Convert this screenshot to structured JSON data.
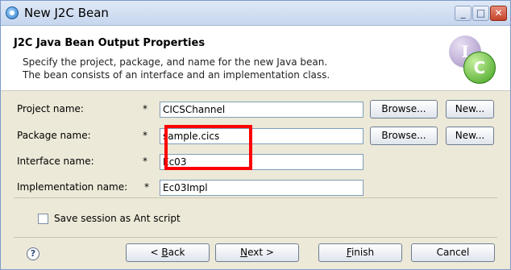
{
  "window": {
    "title": "New J2C Bean"
  },
  "header": {
    "title": "J2C Java Bean Output Properties",
    "desc_line1": "Specify the project, package, and name for the new Java bean.",
    "desc_line2": "The bean consists of an interface and an implementation class.",
    "badge_letter_1": "I",
    "badge_letter_2": "C"
  },
  "form": {
    "project": {
      "label": "Project name:",
      "required": "*",
      "value": "CICSChannel",
      "browse": "Browse...",
      "new": "New..."
    },
    "package": {
      "label": "Package name:",
      "required": "*",
      "value": "sample.cics",
      "browse": "Browse...",
      "new": "New..."
    },
    "interface": {
      "label": "Interface name:",
      "required": "*",
      "value": "Ec03"
    },
    "implementation": {
      "label": "Implementation name:",
      "required": "*",
      "value": "Ec03Impl"
    }
  },
  "options": {
    "save_session_label": "Save session as Ant script",
    "save_session_checked": false
  },
  "footer": {
    "help_glyph": "?",
    "back": {
      "prefix": "< ",
      "accel": "B",
      "rest": "ack"
    },
    "next": {
      "accel": "N",
      "rest": "ext >"
    },
    "finish": {
      "accel": "F",
      "rest": "inish"
    },
    "cancel": "Cancel"
  },
  "colors": {
    "highlight": "#ff0000",
    "window_border": "#7b9bc9"
  }
}
